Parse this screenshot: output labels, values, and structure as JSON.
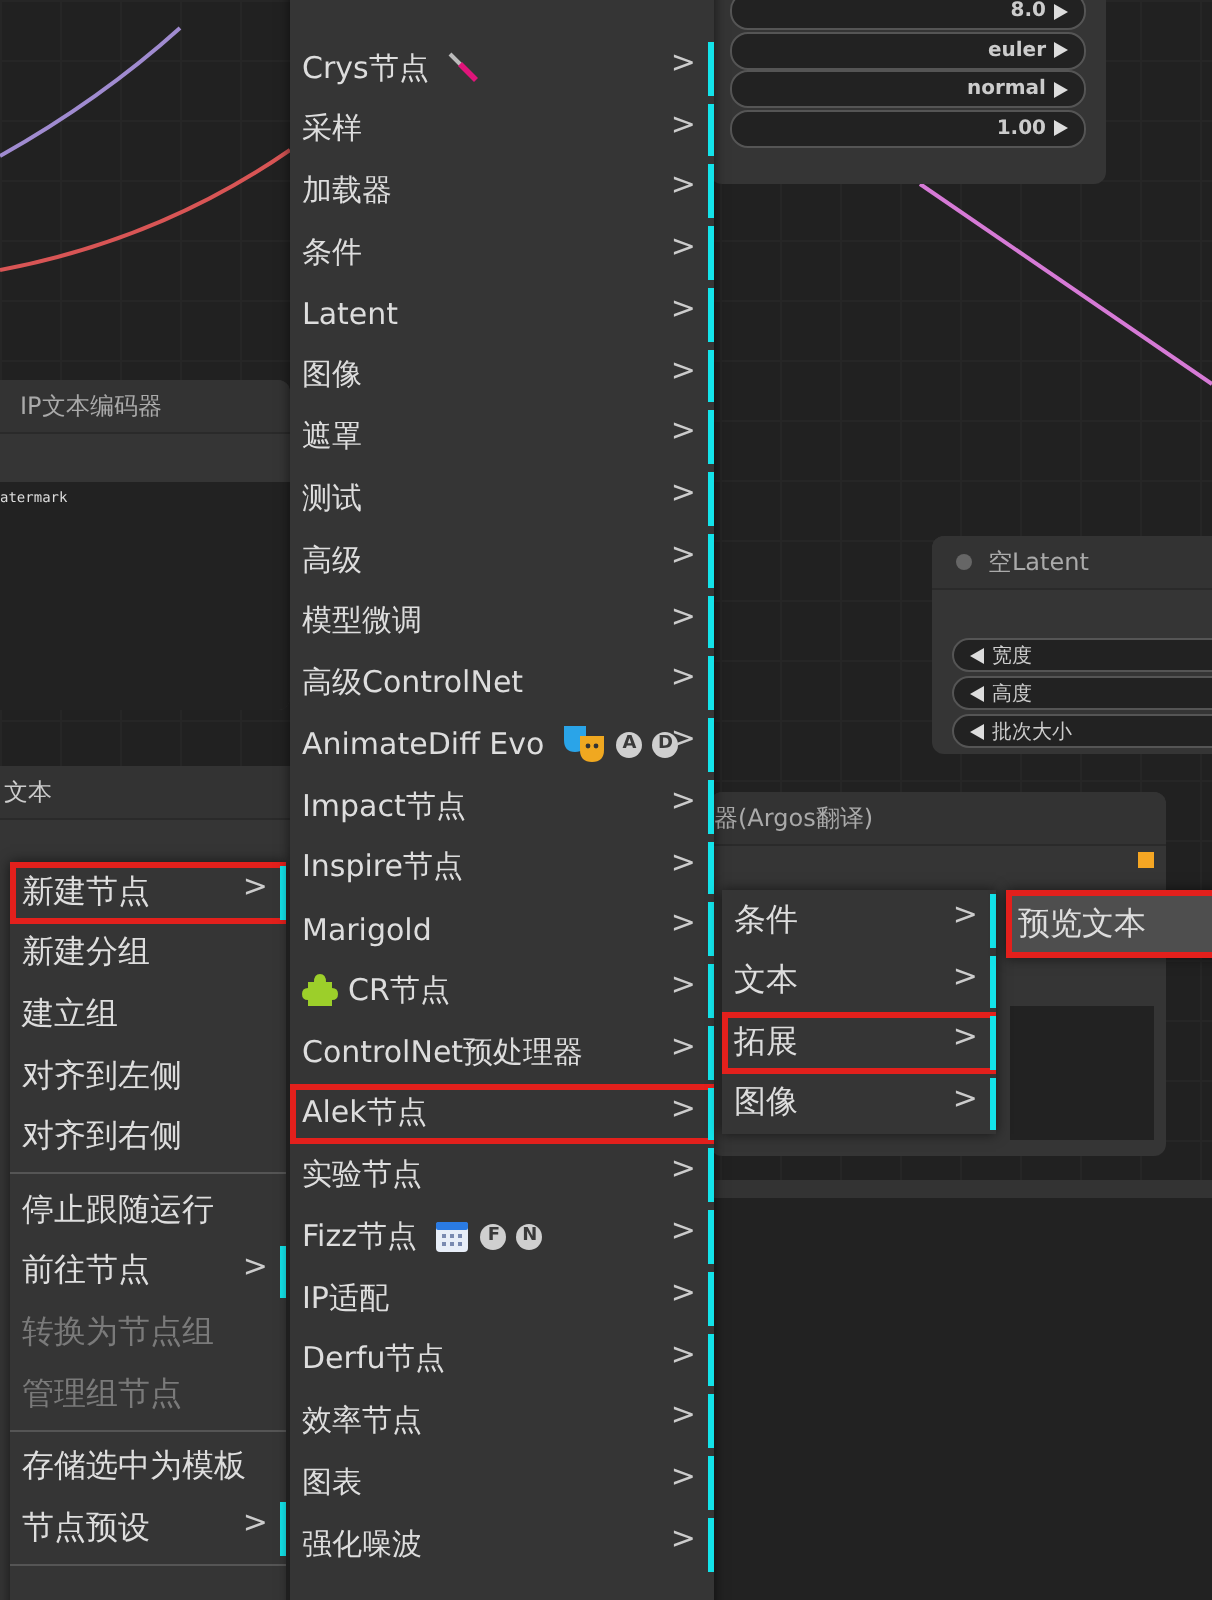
{
  "nodes": [
    {
      "kind": "text_encoder",
      "title": "IP文本编码器",
      "text": "atermark"
    },
    {
      "kind": "text",
      "title": "文本"
    },
    {
      "kind": "sampler",
      "widgets": [
        "8.0",
        "euler",
        "normal",
        "1.00"
      ]
    },
    {
      "kind": "latent",
      "title": "空Latent",
      "widgets": [
        "宽度",
        "高度",
        "批次大小"
      ]
    },
    {
      "kind": "translator",
      "title": "器(Argos翻译)"
    }
  ],
  "menus": [
    {
      "items": [
        {
          "kind": "item",
          "label": "新建节点",
          "arrow": ">",
          "outlined": true,
          "disabled": false
        },
        {
          "kind": "item",
          "label": "新建分组",
          "outlined": false,
          "disabled": false
        },
        {
          "kind": "item",
          "label": "建立组",
          "outlined": false,
          "disabled": false
        },
        {
          "kind": "item",
          "label": "对齐到左侧",
          "outlined": false,
          "disabled": false
        },
        {
          "kind": "item",
          "label": "对齐到右侧",
          "outlined": false,
          "disabled": false
        },
        {
          "kind": "separator"
        },
        {
          "kind": "item",
          "label": "停止跟随运行",
          "outlined": false,
          "disabled": false
        },
        {
          "kind": "item",
          "label": "前往节点",
          "arrow": ">",
          "outlined": false,
          "disabled": false
        },
        {
          "kind": "item",
          "label": "转换为节点组",
          "outlined": false,
          "disabled": true
        },
        {
          "kind": "item",
          "label": "管理组节点",
          "outlined": false,
          "disabled": true
        },
        {
          "kind": "separator"
        },
        {
          "kind": "item",
          "label": "存储选中为模板",
          "outlined": false,
          "disabled": false
        },
        {
          "kind": "item",
          "label": "节点预设",
          "arrow": ">",
          "outlined": false,
          "disabled": false
        },
        {
          "kind": "separator"
        }
      ]
    },
    {
      "items": [
        {
          "kind": "item",
          "label": "Crys节点",
          "arrow": ">",
          "outlined": false
        },
        {
          "kind": "item",
          "label": "采样",
          "arrow": ">",
          "outlined": false
        },
        {
          "kind": "item",
          "label": "加载器",
          "arrow": ">",
          "outlined": false
        },
        {
          "kind": "item",
          "label": "条件",
          "arrow": ">",
          "outlined": false
        },
        {
          "kind": "item",
          "label": "Latent",
          "arrow": ">",
          "outlined": false
        },
        {
          "kind": "item",
          "label": "图像",
          "arrow": ">",
          "outlined": false
        },
        {
          "kind": "item",
          "label": "遮罩",
          "arrow": ">",
          "outlined": false
        },
        {
          "kind": "item",
          "label": "测试",
          "arrow": ">",
          "outlined": false
        },
        {
          "kind": "item",
          "label": "高级",
          "arrow": ">",
          "outlined": false
        },
        {
          "kind": "item",
          "label": "模型微调",
          "arrow": ">",
          "outlined": false
        },
        {
          "kind": "item",
          "label": "高级ControlNet",
          "arrow": ">",
          "outlined": false
        },
        {
          "kind": "item",
          "label": "AnimateDiff Evo",
          "badges": [
            "A",
            "D"
          ],
          "arrow": ">",
          "outlined": false
        },
        {
          "kind": "item",
          "label": "Impact节点",
          "arrow": ">",
          "outlined": false
        },
        {
          "kind": "item",
          "label": "Inspire节点",
          "arrow": ">",
          "outlined": false
        },
        {
          "kind": "item",
          "label": "Marigold",
          "arrow": ">",
          "outlined": false
        },
        {
          "kind": "item",
          "label": "CR节点",
          "arrow": ">",
          "outlined": false
        },
        {
          "kind": "item",
          "label": "ControlNet预处理器",
          "arrow": ">",
          "outlined": false
        },
        {
          "kind": "item",
          "label": "Alek节点",
          "arrow": ">",
          "outlined": true
        },
        {
          "kind": "item",
          "label": "实验节点",
          "arrow": ">",
          "outlined": false
        },
        {
          "kind": "item",
          "label": "Fizz节点",
          "badges": [
            "F",
            "N"
          ],
          "arrow": ">",
          "outlined": false
        },
        {
          "kind": "item",
          "label": "IP适配",
          "arrow": ">",
          "outlined": false
        },
        {
          "kind": "item",
          "label": "Derfu节点",
          "arrow": ">",
          "outlined": false
        },
        {
          "kind": "item",
          "label": "效率节点",
          "arrow": ">",
          "outlined": false
        },
        {
          "kind": "item",
          "label": "图表",
          "arrow": ">",
          "outlined": false
        },
        {
          "kind": "item",
          "label": "强化噪波",
          "arrow": ">",
          "outlined": false
        }
      ]
    },
    {
      "items": [
        {
          "kind": "item",
          "label": "条件",
          "arrow": ">",
          "outlined": false
        },
        {
          "kind": "item",
          "label": "文本",
          "arrow": ">",
          "outlined": false
        },
        {
          "kind": "item",
          "label": "拓展",
          "arrow": ">",
          "outlined": true
        },
        {
          "kind": "item",
          "label": "图像",
          "arrow": ">",
          "outlined": false
        }
      ]
    },
    {
      "items": [
        {
          "kind": "item",
          "label": "预览文本",
          "outlined": true,
          "selected": true
        }
      ]
    }
  ]
}
